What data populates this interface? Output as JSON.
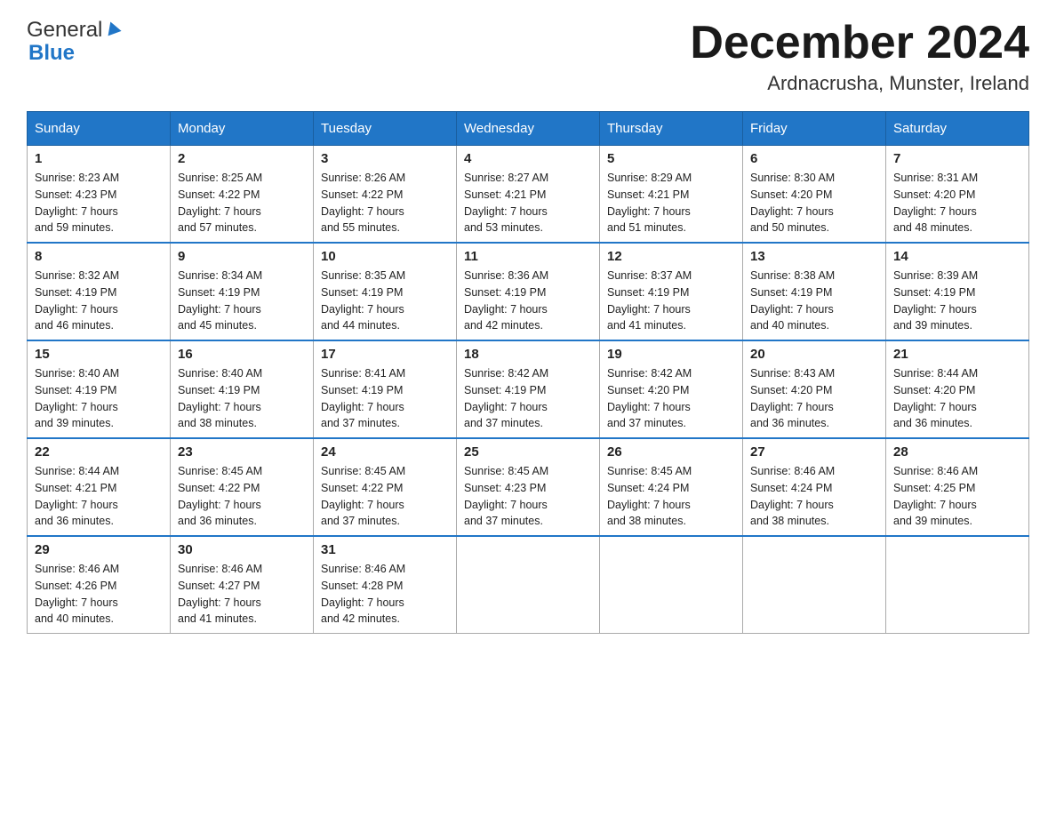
{
  "header": {
    "logo_general": "General",
    "logo_blue": "Blue",
    "title": "December 2024",
    "subtitle": "Ardnacrusha, Munster, Ireland"
  },
  "days_of_week": [
    "Sunday",
    "Monday",
    "Tuesday",
    "Wednesday",
    "Thursday",
    "Friday",
    "Saturday"
  ],
  "weeks": [
    [
      {
        "day": "1",
        "sunrise": "Sunrise: 8:23 AM",
        "sunset": "Sunset: 4:23 PM",
        "daylight": "Daylight: 7 hours",
        "daylight2": "and 59 minutes."
      },
      {
        "day": "2",
        "sunrise": "Sunrise: 8:25 AM",
        "sunset": "Sunset: 4:22 PM",
        "daylight": "Daylight: 7 hours",
        "daylight2": "and 57 minutes."
      },
      {
        "day": "3",
        "sunrise": "Sunrise: 8:26 AM",
        "sunset": "Sunset: 4:22 PM",
        "daylight": "Daylight: 7 hours",
        "daylight2": "and 55 minutes."
      },
      {
        "day": "4",
        "sunrise": "Sunrise: 8:27 AM",
        "sunset": "Sunset: 4:21 PM",
        "daylight": "Daylight: 7 hours",
        "daylight2": "and 53 minutes."
      },
      {
        "day": "5",
        "sunrise": "Sunrise: 8:29 AM",
        "sunset": "Sunset: 4:21 PM",
        "daylight": "Daylight: 7 hours",
        "daylight2": "and 51 minutes."
      },
      {
        "day": "6",
        "sunrise": "Sunrise: 8:30 AM",
        "sunset": "Sunset: 4:20 PM",
        "daylight": "Daylight: 7 hours",
        "daylight2": "and 50 minutes."
      },
      {
        "day": "7",
        "sunrise": "Sunrise: 8:31 AM",
        "sunset": "Sunset: 4:20 PM",
        "daylight": "Daylight: 7 hours",
        "daylight2": "and 48 minutes."
      }
    ],
    [
      {
        "day": "8",
        "sunrise": "Sunrise: 8:32 AM",
        "sunset": "Sunset: 4:19 PM",
        "daylight": "Daylight: 7 hours",
        "daylight2": "and 46 minutes."
      },
      {
        "day": "9",
        "sunrise": "Sunrise: 8:34 AM",
        "sunset": "Sunset: 4:19 PM",
        "daylight": "Daylight: 7 hours",
        "daylight2": "and 45 minutes."
      },
      {
        "day": "10",
        "sunrise": "Sunrise: 8:35 AM",
        "sunset": "Sunset: 4:19 PM",
        "daylight": "Daylight: 7 hours",
        "daylight2": "and 44 minutes."
      },
      {
        "day": "11",
        "sunrise": "Sunrise: 8:36 AM",
        "sunset": "Sunset: 4:19 PM",
        "daylight": "Daylight: 7 hours",
        "daylight2": "and 42 minutes."
      },
      {
        "day": "12",
        "sunrise": "Sunrise: 8:37 AM",
        "sunset": "Sunset: 4:19 PM",
        "daylight": "Daylight: 7 hours",
        "daylight2": "and 41 minutes."
      },
      {
        "day": "13",
        "sunrise": "Sunrise: 8:38 AM",
        "sunset": "Sunset: 4:19 PM",
        "daylight": "Daylight: 7 hours",
        "daylight2": "and 40 minutes."
      },
      {
        "day": "14",
        "sunrise": "Sunrise: 8:39 AM",
        "sunset": "Sunset: 4:19 PM",
        "daylight": "Daylight: 7 hours",
        "daylight2": "and 39 minutes."
      }
    ],
    [
      {
        "day": "15",
        "sunrise": "Sunrise: 8:40 AM",
        "sunset": "Sunset: 4:19 PM",
        "daylight": "Daylight: 7 hours",
        "daylight2": "and 39 minutes."
      },
      {
        "day": "16",
        "sunrise": "Sunrise: 8:40 AM",
        "sunset": "Sunset: 4:19 PM",
        "daylight": "Daylight: 7 hours",
        "daylight2": "and 38 minutes."
      },
      {
        "day": "17",
        "sunrise": "Sunrise: 8:41 AM",
        "sunset": "Sunset: 4:19 PM",
        "daylight": "Daylight: 7 hours",
        "daylight2": "and 37 minutes."
      },
      {
        "day": "18",
        "sunrise": "Sunrise: 8:42 AM",
        "sunset": "Sunset: 4:19 PM",
        "daylight": "Daylight: 7 hours",
        "daylight2": "and 37 minutes."
      },
      {
        "day": "19",
        "sunrise": "Sunrise: 8:42 AM",
        "sunset": "Sunset: 4:20 PM",
        "daylight": "Daylight: 7 hours",
        "daylight2": "and 37 minutes."
      },
      {
        "day": "20",
        "sunrise": "Sunrise: 8:43 AM",
        "sunset": "Sunset: 4:20 PM",
        "daylight": "Daylight: 7 hours",
        "daylight2": "and 36 minutes."
      },
      {
        "day": "21",
        "sunrise": "Sunrise: 8:44 AM",
        "sunset": "Sunset: 4:20 PM",
        "daylight": "Daylight: 7 hours",
        "daylight2": "and 36 minutes."
      }
    ],
    [
      {
        "day": "22",
        "sunrise": "Sunrise: 8:44 AM",
        "sunset": "Sunset: 4:21 PM",
        "daylight": "Daylight: 7 hours",
        "daylight2": "and 36 minutes."
      },
      {
        "day": "23",
        "sunrise": "Sunrise: 8:45 AM",
        "sunset": "Sunset: 4:22 PM",
        "daylight": "Daylight: 7 hours",
        "daylight2": "and 36 minutes."
      },
      {
        "day": "24",
        "sunrise": "Sunrise: 8:45 AM",
        "sunset": "Sunset: 4:22 PM",
        "daylight": "Daylight: 7 hours",
        "daylight2": "and 37 minutes."
      },
      {
        "day": "25",
        "sunrise": "Sunrise: 8:45 AM",
        "sunset": "Sunset: 4:23 PM",
        "daylight": "Daylight: 7 hours",
        "daylight2": "and 37 minutes."
      },
      {
        "day": "26",
        "sunrise": "Sunrise: 8:45 AM",
        "sunset": "Sunset: 4:24 PM",
        "daylight": "Daylight: 7 hours",
        "daylight2": "and 38 minutes."
      },
      {
        "day": "27",
        "sunrise": "Sunrise: 8:46 AM",
        "sunset": "Sunset: 4:24 PM",
        "daylight": "Daylight: 7 hours",
        "daylight2": "and 38 minutes."
      },
      {
        "day": "28",
        "sunrise": "Sunrise: 8:46 AM",
        "sunset": "Sunset: 4:25 PM",
        "daylight": "Daylight: 7 hours",
        "daylight2": "and 39 minutes."
      }
    ],
    [
      {
        "day": "29",
        "sunrise": "Sunrise: 8:46 AM",
        "sunset": "Sunset: 4:26 PM",
        "daylight": "Daylight: 7 hours",
        "daylight2": "and 40 minutes."
      },
      {
        "day": "30",
        "sunrise": "Sunrise: 8:46 AM",
        "sunset": "Sunset: 4:27 PM",
        "daylight": "Daylight: 7 hours",
        "daylight2": "and 41 minutes."
      },
      {
        "day": "31",
        "sunrise": "Sunrise: 8:46 AM",
        "sunset": "Sunset: 4:28 PM",
        "daylight": "Daylight: 7 hours",
        "daylight2": "and 42 minutes."
      },
      {
        "day": "",
        "sunrise": "",
        "sunset": "",
        "daylight": "",
        "daylight2": ""
      },
      {
        "day": "",
        "sunrise": "",
        "sunset": "",
        "daylight": "",
        "daylight2": ""
      },
      {
        "day": "",
        "sunrise": "",
        "sunset": "",
        "daylight": "",
        "daylight2": ""
      },
      {
        "day": "",
        "sunrise": "",
        "sunset": "",
        "daylight": "",
        "daylight2": ""
      }
    ]
  ]
}
